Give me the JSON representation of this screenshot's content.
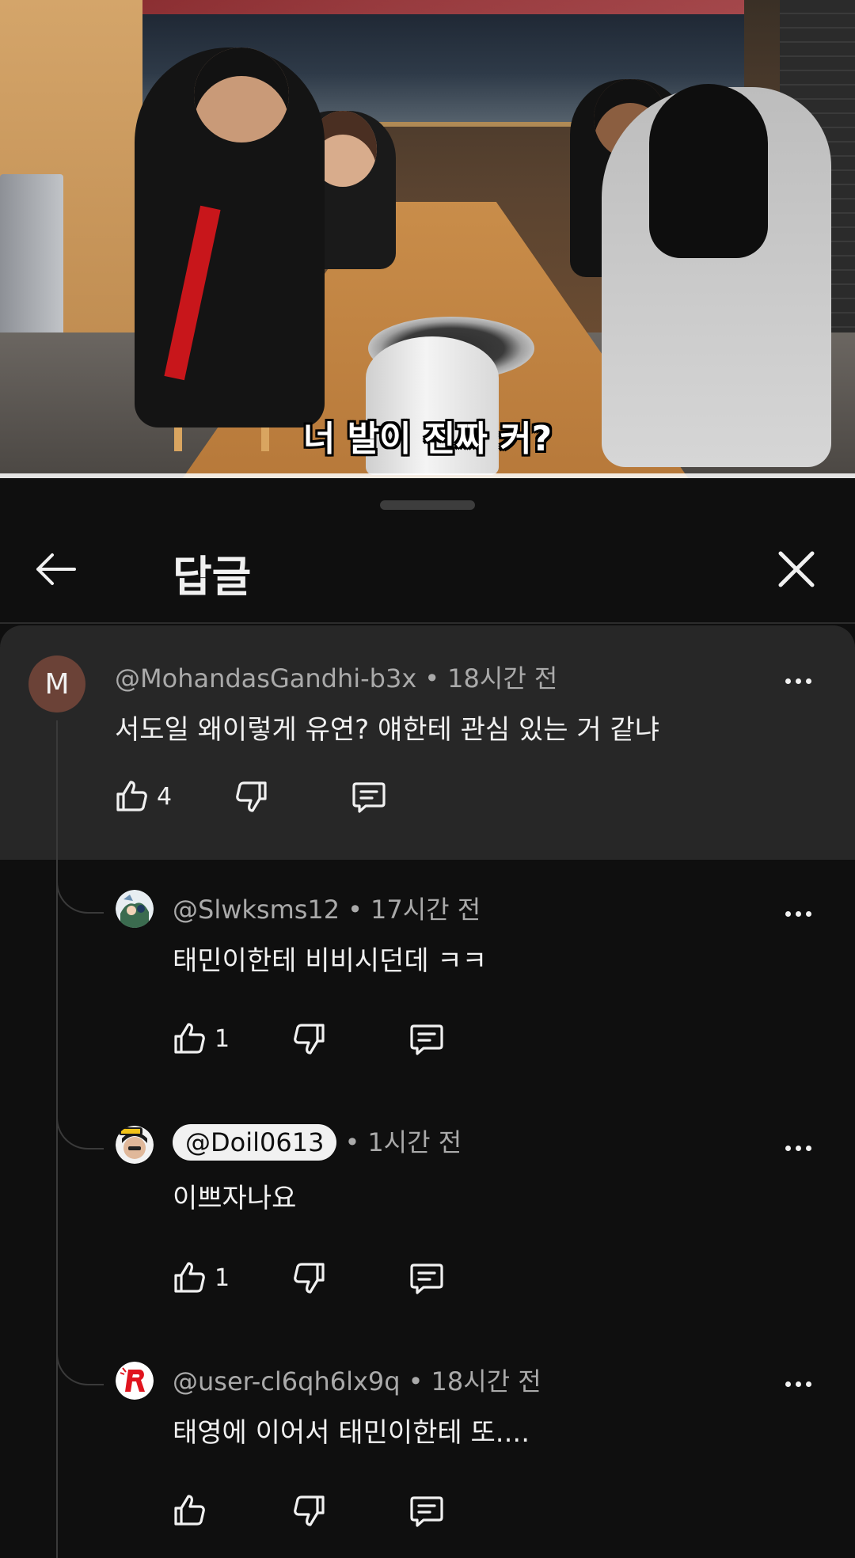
{
  "video": {
    "subtitle": "너 발이 진짜 커?"
  },
  "sheet": {
    "title": "답글"
  },
  "parent_comment": {
    "avatar_letter": "M",
    "handle": "@MohandasGandhi-b3x",
    "time": "18시간 전",
    "text": "서도일 왜이렇게 유연? 얘한테 관심 있는 거 같냐",
    "likes": "4"
  },
  "replies": [
    {
      "handle": "@Slwksms12",
      "time": "17시간 전",
      "text": "태민이한테 비비시던데 ㅋㅋ",
      "likes": "1",
      "avatar_icon": "avatar-anime"
    },
    {
      "handle": "@Doil0613",
      "time": "1시간 전",
      "text": "이쁘자나요",
      "likes": "1",
      "avatar_icon": "avatar-creator"
    },
    {
      "handle": "@user-cl6qh6lx9q",
      "time": "18시간 전",
      "text": "태영에 이어서 태민이한테 또....",
      "likes": "",
      "avatar_icon": "avatar-red-r"
    }
  ],
  "colors": {
    "background": "#0f0f0f",
    "highlight": "#272727",
    "text_primary": "#f1f1f1",
    "text_secondary": "#aaaaaa",
    "avatar_m": "#6b4237"
  }
}
